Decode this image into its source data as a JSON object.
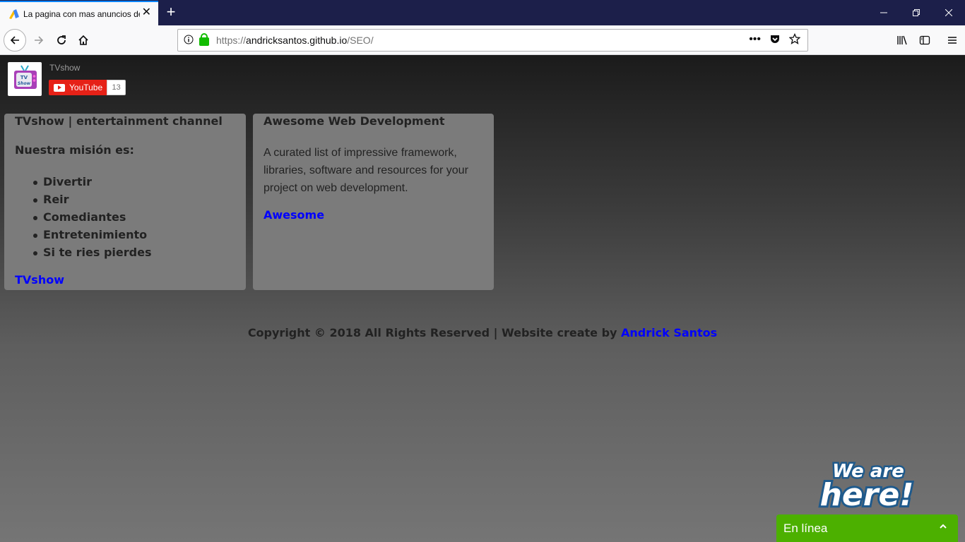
{
  "browser": {
    "tab_title": "La pagina con mas anuncios de",
    "tab_close": "✕",
    "new_tab": "+",
    "url_scheme": "https://",
    "url_host": "andricksantos.github.io",
    "url_path": "/SEO/",
    "url_more": "•••"
  },
  "header": {
    "channel_name": "TVshow",
    "youtube_label": "YouTube",
    "subscriber_count": "13"
  },
  "cards": [
    {
      "title": "TVshow | entertainment channel",
      "mission_heading": "Nuestra misión es:",
      "items": [
        "Divertir",
        "Reir",
        "Comediantes",
        "Entretenimiento",
        "Si te ries pierdes"
      ],
      "link": "TVshow"
    },
    {
      "title": "Awesome Web Development",
      "description": "A curated list of impressive framework, libraries, software and resources for your project on web development.",
      "link": "Awesome"
    }
  ],
  "footer": {
    "text": "Copyright © 2018 All Rights Reserved | Website create by ",
    "author_link": "Andrick Santos"
  },
  "chat": {
    "badge_line1": "We are",
    "badge_line2": "here!",
    "status": "En línea"
  },
  "colors": {
    "tabbar": "#1c1f4a",
    "link": "#0000ff",
    "chat": "#4cb000",
    "youtube": "#e62117"
  }
}
